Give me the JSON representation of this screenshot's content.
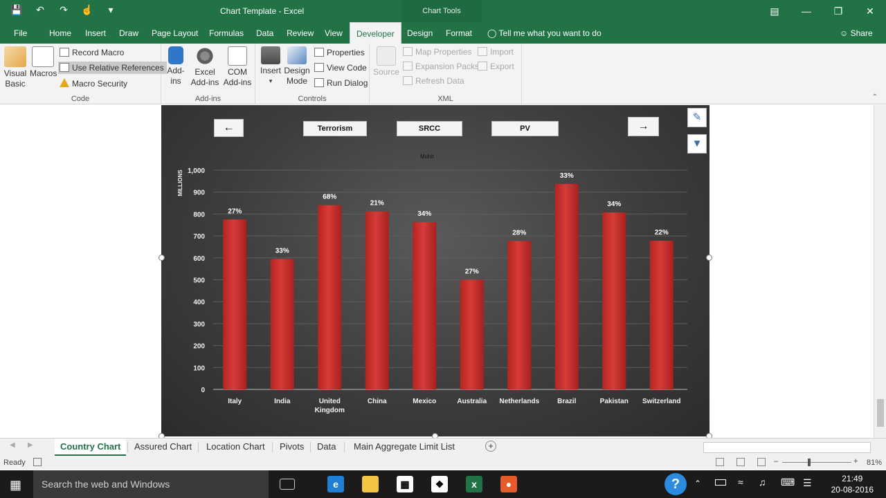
{
  "window": {
    "title": "Chart Template - Excel",
    "context_label": "Chart Tools",
    "brand_color": "#217346"
  },
  "tabs": [
    {
      "label": "File",
      "active": false
    },
    {
      "label": "Home",
      "active": false
    },
    {
      "label": "Insert",
      "active": false
    },
    {
      "label": "Draw",
      "active": false
    },
    {
      "label": "Page Layout",
      "active": false
    },
    {
      "label": "Formulas",
      "active": false
    },
    {
      "label": "Data",
      "active": false
    },
    {
      "label": "Review",
      "active": false
    },
    {
      "label": "View",
      "active": false
    },
    {
      "label": "Developer",
      "active": true
    },
    {
      "label": "Design",
      "active": false
    },
    {
      "label": "Format",
      "active": false
    }
  ],
  "tell_me": "Tell me what you want to do",
  "share_label": "Share",
  "ribbon": {
    "code": {
      "visual_basic": "Visual Basic",
      "macros": "Macros",
      "record_macro": "Record Macro",
      "use_relative": "Use Relative References",
      "macro_security": "Macro Security",
      "group": "Code"
    },
    "addins": {
      "addins": "Add-ins",
      "excel_addins": "Excel Add-ins",
      "com_addins": "COM Add-ins",
      "group": "Add-ins"
    },
    "controls": {
      "insert": "Insert",
      "design_mode": "Design Mode",
      "properties": "Properties",
      "view_code": "View Code",
      "run_dialog": "Run Dialog",
      "group": "Controls"
    },
    "xml": {
      "source": "Source",
      "map_properties": "Map Properties",
      "expansion_packs": "Expansion Packs",
      "refresh_data": "Refresh Data",
      "import": "Import",
      "export": "Export",
      "group": "XML"
    }
  },
  "chart_ui": {
    "prev_arrow": "←",
    "next_arrow": "→",
    "filters": [
      "Terrorism",
      "SRCC",
      "PV"
    ],
    "author": "Mohit"
  },
  "chart_data": {
    "type": "bar",
    "categories": [
      "Italy",
      "India",
      "United Kingdom",
      "China",
      "Mexico",
      "Australia",
      "Netherlands",
      "Brazil",
      "Pakistan",
      "Switzerland"
    ],
    "values": [
      775,
      595,
      840,
      812,
      763,
      500,
      677,
      937,
      807,
      678
    ],
    "data_labels": [
      "27%",
      "33%",
      "68%",
      "21%",
      "34%",
      "27%",
      "28%",
      "33%",
      "34%",
      "22%"
    ],
    "ylabel": "MILLIONS",
    "ylim": [
      0,
      1000
    ],
    "yticks": [
      "0",
      "100",
      "200",
      "300",
      "400",
      "500",
      "600",
      "700",
      "800",
      "900",
      "1,000"
    ],
    "bar_color": "#d63b38",
    "grid": true,
    "legend": "none"
  },
  "sheet_tabs": [
    {
      "label": "Country Chart",
      "active": true
    },
    {
      "label": "Assured Chart",
      "active": false
    },
    {
      "label": "Location Chart",
      "active": false
    },
    {
      "label": "Pivots",
      "active": false
    },
    {
      "label": "Data",
      "active": false
    },
    {
      "label": "Main Aggregate Limit List",
      "active": false
    }
  ],
  "status": {
    "ready": "Ready",
    "zoom": "81%"
  },
  "taskbar": {
    "search_placeholder": "Search the web and Windows",
    "time": "21:49",
    "date": "20-08-2016"
  }
}
